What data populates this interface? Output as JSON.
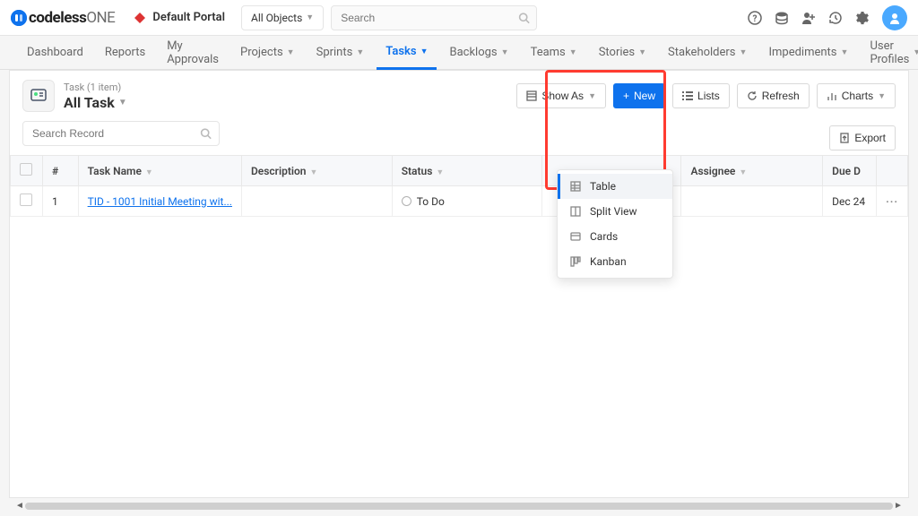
{
  "logo": {
    "bold": "codeless",
    "light": "ONE"
  },
  "portal": "Default Portal",
  "object_selector": "All Objects",
  "search": {
    "placeholder": "Search"
  },
  "nav": [
    {
      "label": "Dashboard",
      "caret": false
    },
    {
      "label": "Reports",
      "caret": false
    },
    {
      "label": "My Approvals",
      "caret": false
    },
    {
      "label": "Projects",
      "caret": true
    },
    {
      "label": "Sprints",
      "caret": true
    },
    {
      "label": "Tasks",
      "caret": true,
      "active": true
    },
    {
      "label": "Backlogs",
      "caret": true
    },
    {
      "label": "Teams",
      "caret": true
    },
    {
      "label": "Stories",
      "caret": true
    },
    {
      "label": "Stakeholders",
      "caret": true
    },
    {
      "label": "Impediments",
      "caret": true
    },
    {
      "label": "User Profiles",
      "caret": true
    }
  ],
  "page": {
    "subtitle": "Task (1 item)",
    "title": "All Task"
  },
  "toolbar": {
    "show_as": "Show As",
    "new": "New",
    "lists": "Lists",
    "refresh": "Refresh",
    "charts": "Charts",
    "export": "Export"
  },
  "search_record": {
    "placeholder": "Search Record"
  },
  "columns": {
    "num": "#",
    "task_name": "Task Name",
    "description": "Description",
    "status": "Status",
    "assignee": "Assignee",
    "due": "Due D"
  },
  "row": {
    "num": "1",
    "name": "TID - 1001 Initial Meeting wit...",
    "status": "To Do",
    "due": "Dec 24"
  },
  "dropdown": {
    "table": "Table",
    "split": "Split View",
    "cards": "Cards",
    "kanban": "Kanban"
  }
}
